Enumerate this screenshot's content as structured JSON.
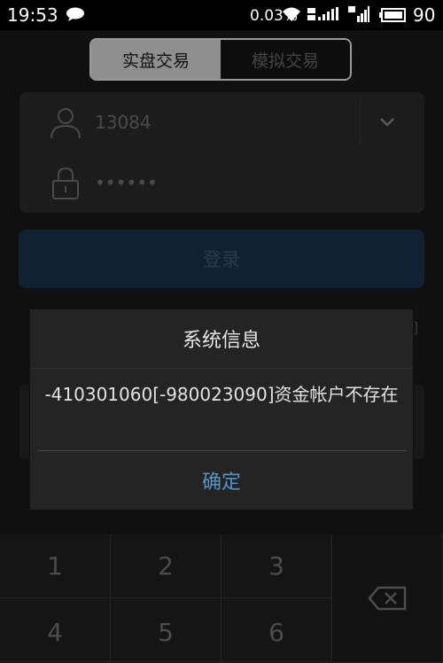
{
  "status_bar": {
    "time": "19:53",
    "net_speed": "0.03%",
    "battery": "90",
    "icons": [
      "chat-icon",
      "wifi-icon",
      "signal-4g-icon",
      "signal-bars-icon",
      "battery-icon"
    ]
  },
  "segment": {
    "tabs": [
      {
        "label": "实盘交易",
        "active": true
      },
      {
        "label": "模拟交易",
        "active": false
      }
    ]
  },
  "login": {
    "account_value": "13084",
    "password_mask": "••••••",
    "login_label": "登录"
  },
  "dialog": {
    "title": "系统信息",
    "message": "-410301060[-980023090]资金帐户不存在",
    "ok_label": "确定"
  },
  "keyboard": {
    "keys": [
      "1",
      "2",
      "3",
      "4",
      "5",
      "6"
    ],
    "delete_icon": "backspace-icon"
  },
  "colors": {
    "accent": "#4f95c8",
    "login_button": "#0f2133"
  }
}
